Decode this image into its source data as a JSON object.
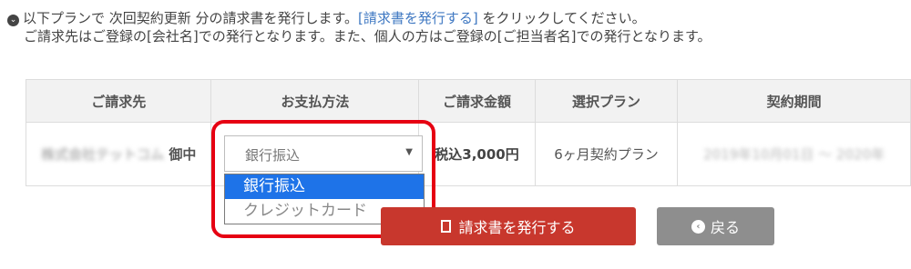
{
  "notice": {
    "icon": "chevron-down-circle-icon",
    "text_before": "以下プランで 次回契約更新 分の請求書を発行します。",
    "link_text": "[請求書を発行する]",
    "text_after": " をクリックしてください。",
    "line2": "ご請求先はご登録の[会社名]での発行となります。また、個人の方はご登録の[ご担当者名]での発行となります。"
  },
  "table": {
    "headers": [
      "ご請求先",
      "お支払方法",
      "ご請求金額",
      "選択プラン",
      "契約期間"
    ],
    "row": {
      "client_name": "株式会社テットコム",
      "client_suffix": " 御中",
      "amount": "税込3,000円",
      "plan": "6ヶ月契約プラン",
      "period": "2019年10月01日 〜 2020年"
    }
  },
  "payment_select": {
    "value": "銀行振込",
    "options": [
      "銀行振込",
      "クレジットカード"
    ],
    "selected_index": 0
  },
  "buttons": {
    "issue": "請求書を発行する",
    "back": "戻る"
  },
  "colors": {
    "highlight": "#e60012",
    "issue_button": "#c8372d",
    "back_button": "#8e8e8e",
    "selected_option": "#1e73e8",
    "link": "#3f78c2"
  }
}
